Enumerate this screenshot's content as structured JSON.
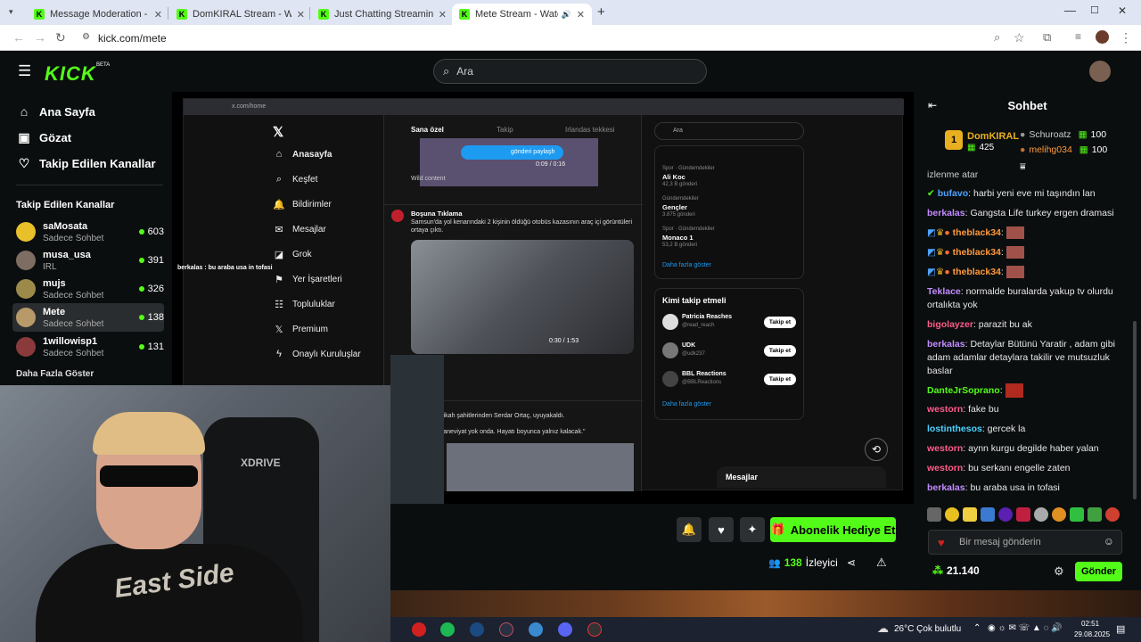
{
  "browser": {
    "tabs": [
      {
        "title": "Message Moderation - Kick Da",
        "active": false
      },
      {
        "title": "DomKIRAL Stream - Watch Live",
        "active": false
      },
      {
        "title": "Just Chatting Streaming - Live S",
        "active": false
      },
      {
        "title": "Mete Stream - Watch Live o",
        "active": true
      }
    ],
    "url": "kick.com/mete"
  },
  "kick": {
    "logo": "KICK",
    "beta": "BETA",
    "search_placeholder": "Ara",
    "accent": "#53fc18"
  },
  "sidebar": {
    "nav": [
      "Ana Sayfa",
      "Gözat",
      "Takip Edilen Kanallar"
    ],
    "section_title": "Takip Edilen Kanallar",
    "channels": [
      {
        "name": "saMosata",
        "category": "Sadece Sohbet",
        "viewers": "603"
      },
      {
        "name": "musa_usa",
        "category": "IRL",
        "viewers": "391"
      },
      {
        "name": "mujs",
        "category": "Sadece Sohbet",
        "viewers": "326"
      },
      {
        "name": "Mete",
        "category": "Sadece Sohbet",
        "viewers": "138"
      },
      {
        "name": "1willowisp1",
        "category": "Sadece Sohbet",
        "viewers": "131"
      }
    ],
    "show_more": "Daha Fazla Göster"
  },
  "stream": {
    "x_url": "x.com/home",
    "x_nav": [
      "Anasayfa",
      "Keşfet",
      "Bildirimler",
      "Mesajlar",
      "Grok",
      "Yer İşaretleri",
      "Topluluklar",
      "Premium",
      "Onaylı Kuruluşlar"
    ],
    "x_tabs": [
      "Sana özel",
      "Takip",
      "Irlandas tekkesi"
    ],
    "x_search": "Ara",
    "tweet1_author": "Boşuna Tıklama",
    "tweet1_text": "Samsun'da yol kenarındaki 2 kişinin öldüğü otobüs kazasının araç içi görüntüleri ortaya çıktı.",
    "tweet1_video_time": "0:30 / 1:53",
    "tweet2_text": "Erbil'in nikah şahitlerinden Serdar Ortaç, uyuyakaldı.",
    "tweet2_quote": "Erbil: \"Maneviyat yok onda. Hayatı boyunca yalnız kalacak.\"",
    "wild_content": "Wild content",
    "share_pill": "gönderi paylaşh",
    "video_time_top": "0:09 / 0:16",
    "trends": [
      {
        "label": "Spor · Gündemdekiler",
        "name": "Ali Koc",
        "posts": "42,3 B gönderi"
      },
      {
        "label": "Gündemdekiler",
        "name": "Gençler",
        "posts": "3.875 gönderi"
      },
      {
        "label": "Spor · Gündemdekiler",
        "name": "Monaco 1",
        "posts": "53,2 B gönderi"
      }
    ],
    "show_more": "Daha fazla göster",
    "who_to_follow": "Kimi takip etmeli",
    "follows": [
      {
        "name": "Patricia Reaches",
        "handle": "@read_reach"
      },
      {
        "name": "UDK",
        "handle": "@udk237"
      },
      {
        "name": "BBL Reactions",
        "handle": "@BBLReactions"
      }
    ],
    "follow_btn": "Takip et",
    "messages": "Mesajlar",
    "overlay_chat": "berkalas : bu araba usa in tofasi",
    "cam_shirt": "East Side",
    "chair_brand": "XDRIVE"
  },
  "actions": {
    "gift_label": "Abonelik Hediye Et",
    "viewer_count": "138",
    "viewer_label": "İzleyici"
  },
  "chat": {
    "title": "Sohbet",
    "top_gifter": {
      "name": "DomKIRAL",
      "count": "425",
      "rank": "1"
    },
    "gifters": [
      {
        "name": "Schuroatz",
        "count": "100"
      },
      {
        "name": "melihg034",
        "count": "100"
      }
    ],
    "messages": [
      {
        "user": "",
        "text": "izlenme atar",
        "color": "#e8e8e8"
      },
      {
        "user": "bufavo",
        "text": ": harbi yeni eve mi taşındın lan",
        "color": "#4da3ff"
      },
      {
        "user": "berkalas",
        "text": ": Gangsta Life turkey ergen dramasi",
        "color": "#c48cff"
      },
      {
        "user": "theblack34",
        "text": ":",
        "color": "#ff9a3c"
      },
      {
        "user": "theblack34",
        "text": ":",
        "color": "#ff9a3c"
      },
      {
        "user": "theblack34",
        "text": ":",
        "color": "#ff9a3c"
      },
      {
        "user": "Teklace",
        "text": ": normalde buralarda yakup tv olurdu ortalıkta yok",
        "color": "#c48cff"
      },
      {
        "user": "bigolayzer",
        "text": ": parazit bu ak",
        "color": "#ff5c8a"
      },
      {
        "user": "berkalas",
        "text": ": Detaylar Bütünü Yaratir , adam gibi adam adamlar detaylara takilir ve mutsuzluk baslar",
        "color": "#c48cff"
      },
      {
        "user": "DanteJrSoprano",
        "text": ":",
        "color": "#53fc18"
      },
      {
        "user": "westorn",
        "text": ": fake bu",
        "color": "#ff5c8a"
      },
      {
        "user": "lostinthesos",
        "text": ": gercek la",
        "color": "#4dd2ff"
      },
      {
        "user": "westorn",
        "text": ": aynn kurgu degilde haber yalan",
        "color": "#ff5c8a"
      },
      {
        "user": "westorn",
        "text": ": bu serkanı engelle zaten",
        "color": "#ff5c8a"
      },
      {
        "user": "berkalas",
        "text": ": bu araba usa in tofasi",
        "color": "#c48cff"
      }
    ],
    "input_placeholder": "Bir mesaj gönderin",
    "points": "21.140",
    "send_label": "Gönder"
  },
  "taskbar": {
    "weather": "26°C  Çok bulutlu",
    "time": "02:51",
    "date": "29.08.2025"
  }
}
